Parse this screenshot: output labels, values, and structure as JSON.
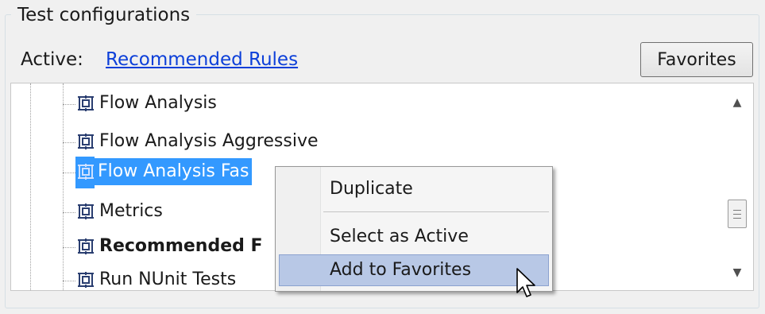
{
  "group": {
    "title": "Test configurations"
  },
  "active": {
    "label": "Active:",
    "link": "Recommended Rules"
  },
  "favorites_button": {
    "label": "Favorites"
  },
  "tree": {
    "items": [
      {
        "label": "Flow Analysis",
        "selected": false,
        "bold": false
      },
      {
        "label": "Flow Analysis Aggressive",
        "selected": false,
        "bold": false
      },
      {
        "label": "Flow Analysis Fas",
        "selected": true,
        "bold": false
      },
      {
        "label": "Metrics",
        "selected": false,
        "bold": false
      },
      {
        "label": "Recommended F",
        "selected": false,
        "bold": true
      },
      {
        "label": "Run NUnit Tests",
        "selected": false,
        "bold": false
      }
    ]
  },
  "context_menu": {
    "items": [
      {
        "label": "Duplicate",
        "hover": false
      },
      {
        "label": "Select as Active",
        "hover": false
      },
      {
        "label": "Add to Favorites",
        "hover": true
      }
    ]
  },
  "icons": {
    "config": "test-configuration-icon",
    "cursor": "mouse-pointer-icon",
    "scroll_up": "scroll-up-arrow-icon",
    "scroll_down": "scroll-down-arrow-icon"
  },
  "colors": {
    "selection": "#3399ff",
    "link": "#0c3fd9",
    "menu_hover": "#b8c8e6"
  }
}
